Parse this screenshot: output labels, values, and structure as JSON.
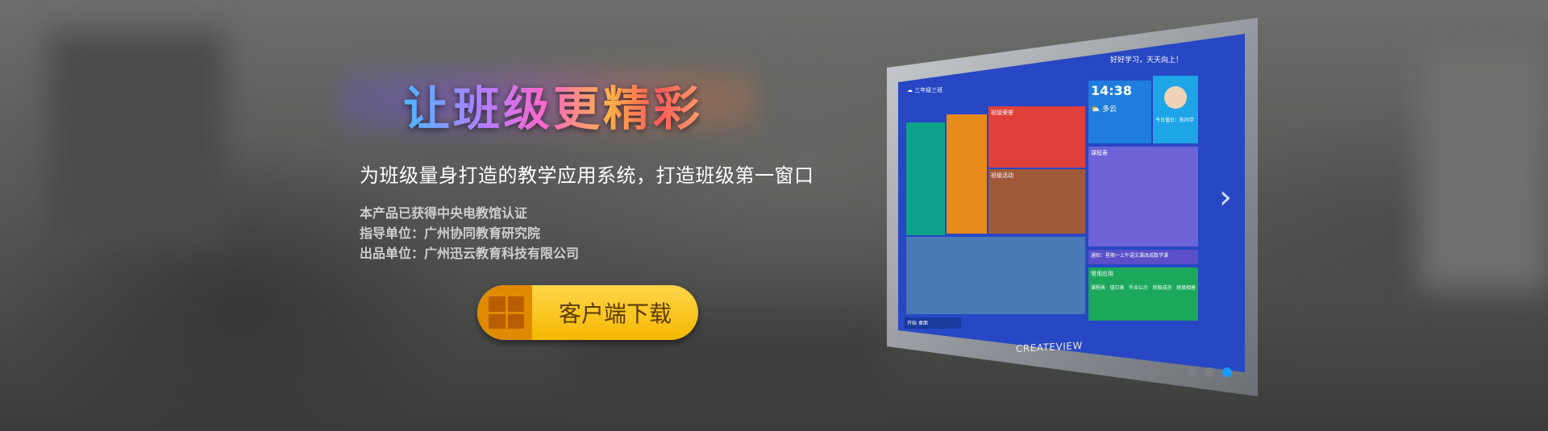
{
  "hero": {
    "title": "让班级更精彩",
    "subtitle": "为班级量身打造的教学应用系统，打造班级第一窗口",
    "info_lines": [
      "本产品已获得中央电教馆认证",
      "指导单位：广州协同教育研究院",
      "出品单位：广州迅云教育科技有限公司"
    ],
    "download_label": "客户端下载"
  },
  "monitor": {
    "brand": "CREATEVIEW",
    "slogan": "好好学习，天天向上！",
    "school": "三年级三班",
    "clock": "14:38",
    "weather": "多云",
    "honor_title": "班级荣誉",
    "activity_title": "班级活动",
    "schedule_title": "课程表",
    "notice": "通知：星期一上午语文课改成数学课",
    "apps_title": "常用应用",
    "apps": [
      "课程表",
      "值日表",
      "作业公示",
      "班级成员",
      "班级相册"
    ],
    "start": "开始",
    "desktop": "桌面",
    "today": "今日值日：陈同学"
  },
  "carousel": {
    "active_index": 2,
    "count": 3
  },
  "colors": {
    "accent": "#f5b800",
    "screen": "#2747c4",
    "active_dot": "#1b9bff"
  }
}
